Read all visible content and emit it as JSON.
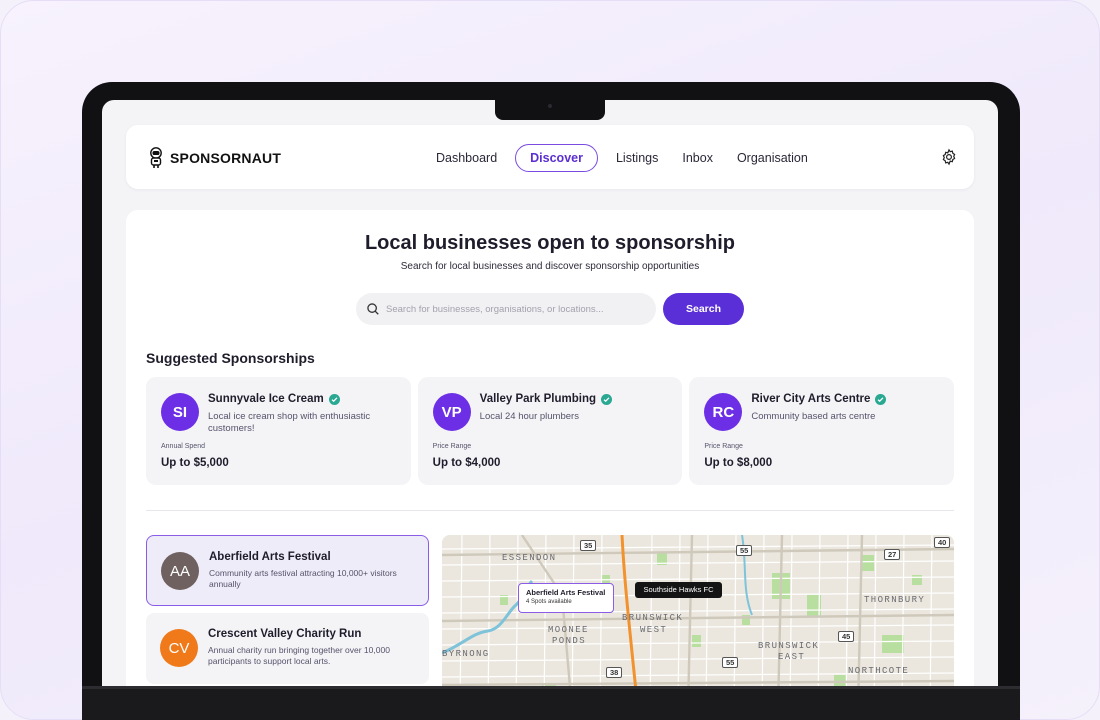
{
  "app": {
    "brand": "SPONSORNAUT",
    "colors": {
      "accent": "#5b2fd8",
      "avatar_purple": "#6d2fe6",
      "avatar_gray": "#6e6160",
      "avatar_orange": "#f07a1a",
      "verified": "#2aa892"
    }
  },
  "nav": {
    "items": [
      "Dashboard",
      "Discover",
      "Listings",
      "Inbox",
      "Organisation"
    ],
    "active": "Discover",
    "settings_icon": "gear-icon"
  },
  "hero": {
    "title": "Local businesses open to sponsorship",
    "subtitle": "Search for local businesses and discover sponsorship opportunities"
  },
  "search": {
    "placeholder": "Search for businesses, organisations, or locations...",
    "button": "Search"
  },
  "suggested": {
    "title": "Suggested Sponsorships",
    "cards": [
      {
        "initials": "SI",
        "name": "Sunnyvale Ice Cream",
        "desc": "Local ice cream shop with enthusiastic customers!",
        "label": "Annual Spend",
        "value": "Up to $5,000"
      },
      {
        "initials": "VP",
        "name": "Valley Park Plumbing",
        "desc": "Local 24 hour plumbers",
        "label": "Price Range",
        "value": "Up to $4,000"
      },
      {
        "initials": "RC",
        "name": "River City Arts Centre",
        "desc": "Community based arts centre",
        "label": "Price Range",
        "value": "Up to $8,000"
      }
    ]
  },
  "listings": [
    {
      "initials": "AA",
      "name": "Aberfield Arts Festival",
      "desc": "Community arts festival attracting 10,000+ visitors annually"
    },
    {
      "initials": "CV",
      "name": "Crescent Valley Charity Run",
      "desc": "Annual charity run bringing together over 10,000 participants to support local arts."
    }
  ],
  "map": {
    "labels": [
      "ESSENDON",
      "MOONEE",
      "PONDS",
      "BRUNSWICK",
      "WEST",
      "BRUNSWICK",
      "EAST",
      "THORNBURY",
      "NORTHCOTE",
      "BYRNONG"
    ],
    "shields": [
      "35",
      "55",
      "27",
      "40",
      "45",
      "55",
      "38"
    ],
    "pins": {
      "selected_title": "Aberfield Arts Festival",
      "selected_sub": "4 Spots available",
      "other": "Southside Hawks FC"
    }
  }
}
